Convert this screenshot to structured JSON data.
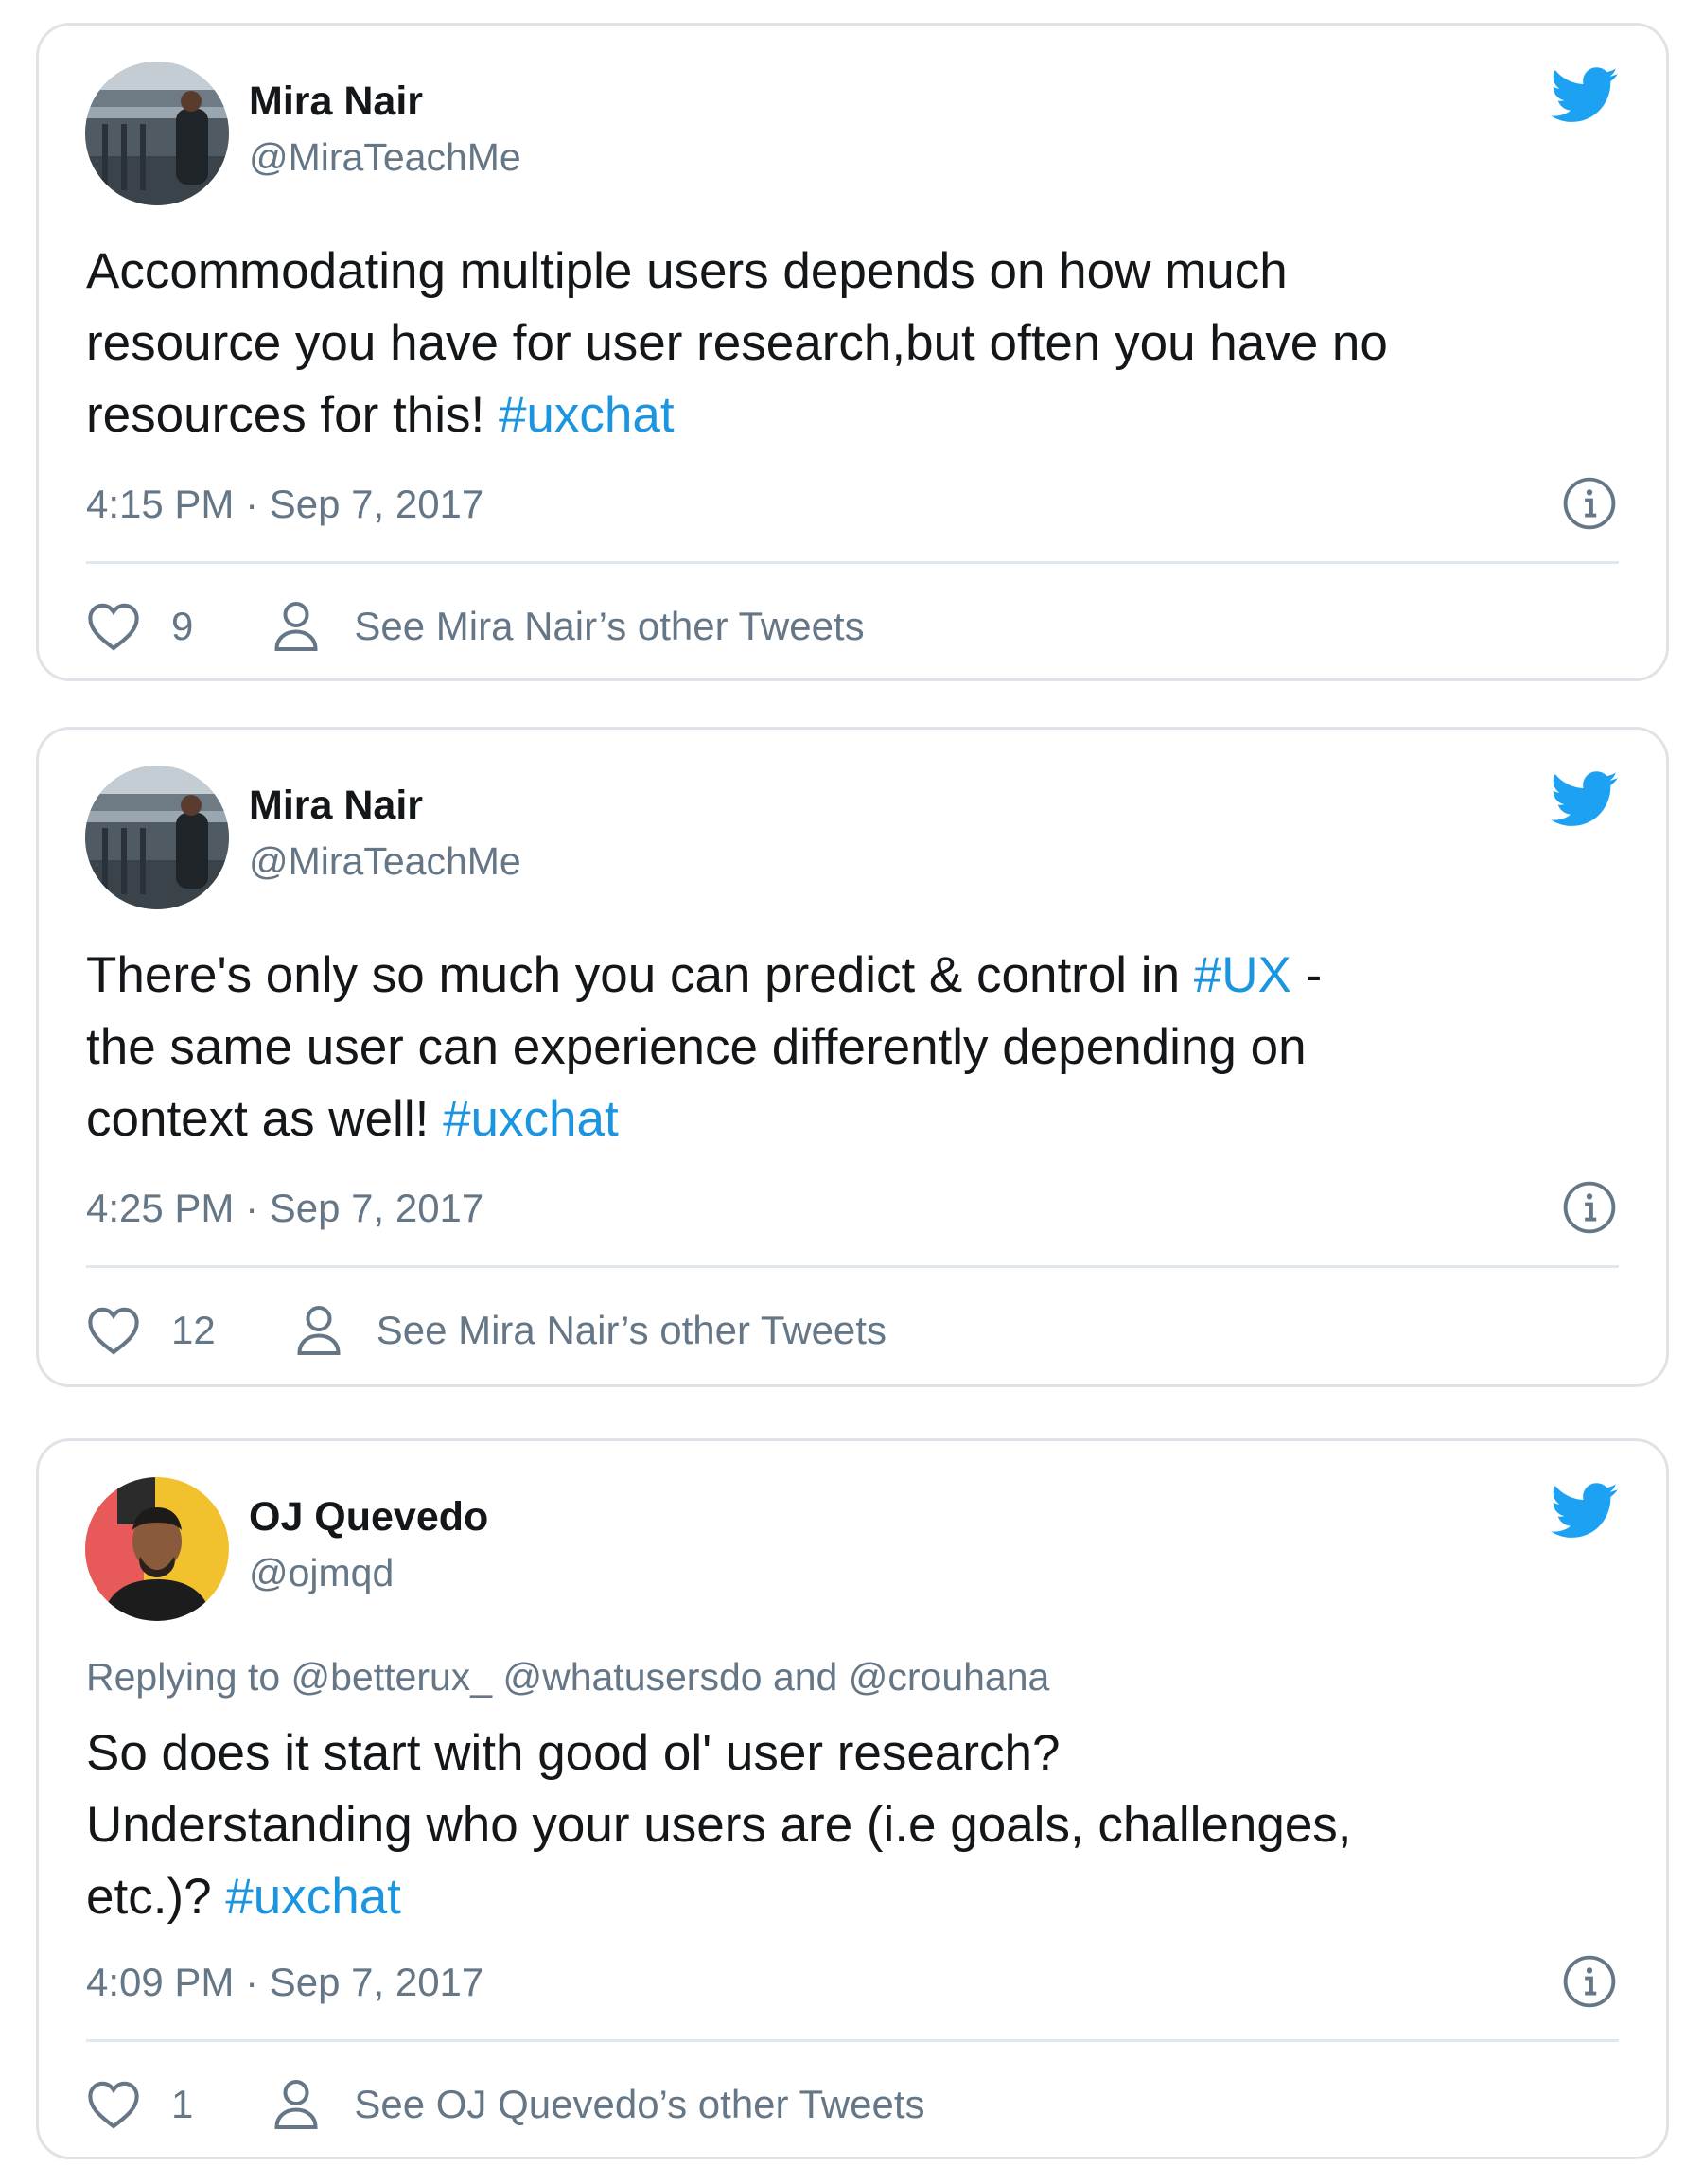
{
  "colors": {
    "twitter_blue": "#1da1f2",
    "hashtag_blue": "#1b95e0",
    "text_primary": "#14171a",
    "text_secondary": "#657786",
    "card_border": "#dfe3e7"
  },
  "tweets": [
    {
      "name": "Mira Nair",
      "handle": "@MiraTeachMe",
      "avatar": "outdoor-river-photo",
      "replying_to": "",
      "text_lines": [
        [
          "Accommodating multiple users depends on how much"
        ],
        [
          "resource you have for user research,but often you have no"
        ],
        [
          "resources for this! ",
          "#uxchat"
        ]
      ],
      "timestamp": "4:15 PM · Sep 7, 2017",
      "likes": "9",
      "profile_link": "See Mira Nair’s other Tweets"
    },
    {
      "name": "Mira Nair",
      "handle": "@MiraTeachMe",
      "avatar": "outdoor-river-photo",
      "replying_to": "",
      "text_lines": [
        [
          "There's only so much you can predict & control in ",
          "#UX",
          " -"
        ],
        [
          "the same user can experience differently depending on"
        ],
        [
          "context as well! ",
          "#uxchat"
        ]
      ],
      "timestamp": "4:25 PM · Sep 7, 2017",
      "likes": "12",
      "profile_link": "See Mira Nair’s other Tweets"
    },
    {
      "name": "OJ Quevedo",
      "handle": "@ojmqd",
      "avatar": "portrait-color-block",
      "replying_to": "Replying to @betterux_ @whatusersdo and @crouhana",
      "text_lines": [
        [
          "So does it start with good ol' user research?"
        ],
        [
          "Understanding who your users are (i.e goals, challenges,"
        ],
        [
          "etc.)? ",
          "#uxchat"
        ]
      ],
      "timestamp": "4:09 PM · Sep 7, 2017",
      "likes": "1",
      "profile_link": "See OJ Quevedo’s other Tweets"
    }
  ]
}
